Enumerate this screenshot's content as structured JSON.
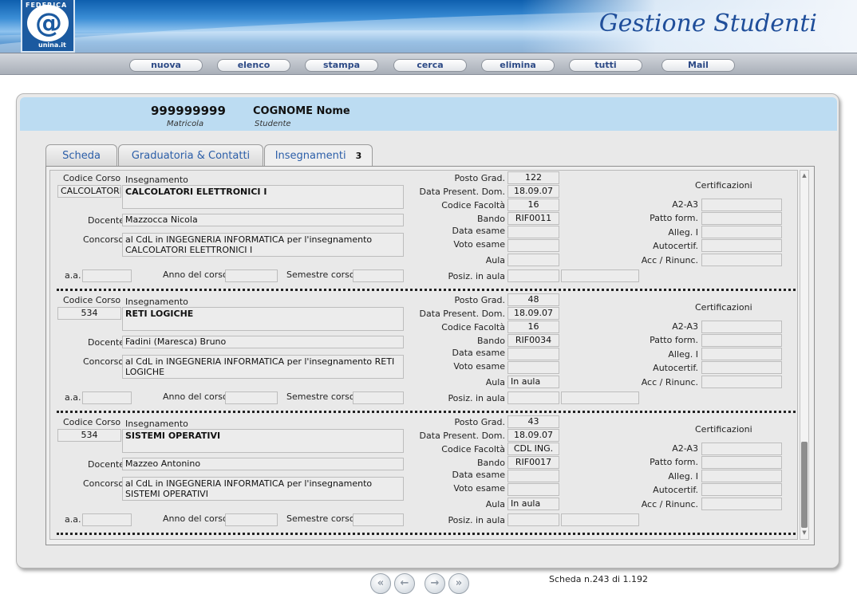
{
  "header": {
    "logo_brand": "FEDERICA",
    "logo_symbol": "@",
    "logo_sub": "unina.it",
    "title": "Gestione Studenti"
  },
  "nav": [
    {
      "label": "nuova"
    },
    {
      "label": "elenco"
    },
    {
      "label": "stampa"
    },
    {
      "label": "cerca"
    },
    {
      "label": "elimina"
    },
    {
      "label": "tutti"
    },
    {
      "label": "Mail"
    }
  ],
  "student": {
    "matricola": "999999999",
    "matricola_label": "Matricola",
    "name": "COGNOME Nome",
    "name_label": "Studente"
  },
  "tabs": [
    {
      "label": "Scheda"
    },
    {
      "label": "Graduatoria & Contatti"
    },
    {
      "label": "Insegnamenti",
      "badge": "3"
    }
  ],
  "labels": {
    "codice_corso": "Codice Corso",
    "insegnamento": "Insegnamento",
    "docente": "Docente",
    "concorso": "Concorso",
    "aa": "a.a.",
    "anno_corso": "Anno del corso",
    "semestre": "Semestre corso",
    "posto_grad": "Posto Grad.",
    "data_present": "Data Present. Dom.",
    "codice_facolta": "Codice Facoltà",
    "bando": "Bando",
    "data_esame": "Data esame",
    "voto_esame": "Voto esame",
    "aula": "Aula",
    "posiz_aula": "Posiz. in aula",
    "certificazioni": "Certificazioni",
    "a2a3": "A2-A3",
    "patto": "Patto form.",
    "alleg": "Alleg. I",
    "autocert": "Autocertif.",
    "acc": "Acc / Rinunc."
  },
  "records": [
    {
      "codice_corso": "CALCOLATORI",
      "insegnamento": "CALCOLATORI ELETTRONICI I",
      "docente": "Mazzocca Nicola",
      "concorso": "al CdL in INGEGNERIA INFORMATICA per l'insegnamento CALCOLATORI ELETTRONICI I",
      "aa": "",
      "anno_corso": "",
      "semestre": "",
      "posto_grad": "122",
      "data_present": "18.09.07",
      "codice_facolta": "16",
      "bando": "RIF0011",
      "data_esame": "",
      "voto_esame": "",
      "aula": "",
      "posiz_aula": "",
      "posiz_aula_2": "",
      "a2a3": "",
      "patto": "",
      "alleg": "",
      "autocert": "",
      "acc": ""
    },
    {
      "codice_corso": "534",
      "insegnamento": "RETI LOGICHE",
      "docente": "Fadini (Maresca) Bruno",
      "concorso": "al CdL in INGEGNERIA INFORMATICA per l'insegnamento RETI LOGICHE",
      "aa": "",
      "anno_corso": "",
      "semestre": "",
      "posto_grad": "48",
      "data_present": "18.09.07",
      "codice_facolta": "16",
      "bando": "RIF0034",
      "data_esame": "",
      "voto_esame": "",
      "aula": "In aula",
      "posiz_aula": "",
      "posiz_aula_2": "",
      "a2a3": "",
      "patto": "",
      "alleg": "",
      "autocert": "",
      "acc": ""
    },
    {
      "codice_corso": "534",
      "insegnamento": "SISTEMI OPERATIVI",
      "docente": "Mazzeo Antonino",
      "concorso": "al CdL in INGEGNERIA INFORMATICA per l'insegnamento SISTEMI OPERATIVI",
      "aa": "",
      "anno_corso": "",
      "semestre": "",
      "posto_grad": "43",
      "data_present": "18.09.07",
      "codice_facolta": "CDL ING.",
      "bando": "RIF0017",
      "data_esame": "",
      "voto_esame": "",
      "aula": "In aula",
      "posiz_aula": "",
      "posiz_aula_2": "",
      "a2a3": "",
      "patto": "",
      "alleg": "",
      "autocert": "",
      "acc": ""
    }
  ],
  "pager": {
    "first": "«",
    "prev": "←",
    "next": "→",
    "last": "»",
    "status": "Scheda n.243  di  1.192"
  }
}
